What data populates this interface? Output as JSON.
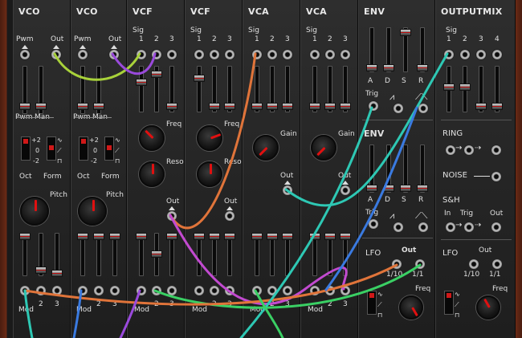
{
  "modules": {
    "vco1": {
      "title": "VCO",
      "pwm": "Pwm",
      "out": "Out",
      "pwm_label": "Pwm",
      "man_label": "Man",
      "plus2": "+2",
      "zero": "0",
      "minus2": "-2",
      "oct": "Oct",
      "form": "Form",
      "pitch": "Pitch",
      "mod": "Mod",
      "in2": "2",
      "in3": "3"
    },
    "vco2": {
      "title": "VCO",
      "pwm": "Pwm",
      "out": "Out",
      "pwm_label": "Pwm",
      "man_label": "Man",
      "plus2": "+2",
      "zero": "0",
      "minus2": "-2",
      "oct": "Oct",
      "form": "Form",
      "pitch": "Pitch",
      "mod": "Mod",
      "in2": "2",
      "in3": "3"
    },
    "vcf1": {
      "title": "VCF",
      "sig": "Sig",
      "s1": "1",
      "s2": "2",
      "s3": "3",
      "freq": "Freq",
      "reso": "Reso",
      "out": "Out",
      "mod": "Mod",
      "in2": "2",
      "in3": "3"
    },
    "vcf2": {
      "title": "VCF",
      "sig": "Sig",
      "s1": "1",
      "s2": "2",
      "s3": "3",
      "freq": "Freq",
      "reso": "Reso",
      "out": "Out",
      "mod": "Mod",
      "in2": "2",
      "in3": "3"
    },
    "vca1": {
      "title": "VCA",
      "sig": "Sig",
      "s1": "1",
      "s2": "2",
      "s3": "3",
      "gain": "Gain",
      "out": "Out",
      "mod": "Mod",
      "in2": "2",
      "in3": "3"
    },
    "vca2": {
      "title": "VCA",
      "sig": "Sig",
      "s1": "1",
      "s2": "2",
      "s3": "3",
      "gain": "Gain",
      "out": "Out",
      "mod": "Mod",
      "in2": "2",
      "in3": "3"
    },
    "env1": {
      "title": "ENV",
      "a": "A",
      "d": "D",
      "s": "S",
      "r": "R",
      "trig": "Trig"
    },
    "env2": {
      "title": "ENV",
      "a": "A",
      "d": "D",
      "s": "S",
      "r": "R",
      "trig": "Trig"
    },
    "lfo": {
      "title": "LFO",
      "out": "Out",
      "r110": "1/10",
      "r11": "1/1",
      "freq": "Freq"
    },
    "outputmix": {
      "title": "OUTPUTMIX",
      "sig": "Sig",
      "s1": "1",
      "s2": "2",
      "s3": "3",
      "s4": "4"
    },
    "ring": {
      "title": "RING"
    },
    "noise": {
      "title": "NOISE"
    },
    "sh": {
      "title": "S&H",
      "in": "In",
      "trig": "Trig",
      "out": "Out"
    },
    "lfo2": {
      "title": "LFO",
      "out": "Out",
      "r110": "1/10",
      "r11": "1/1",
      "freq": "Freq"
    }
  },
  "cable_colors": {
    "yellowgreen": "#a8d23a",
    "purple": "#9a4adc",
    "orange": "#e0743a",
    "teal": "#2ec8b4",
    "magenta": "#c24ad0",
    "green": "#3ad064",
    "blue": "#3a7ae0",
    "olive": "#7aa83a"
  }
}
